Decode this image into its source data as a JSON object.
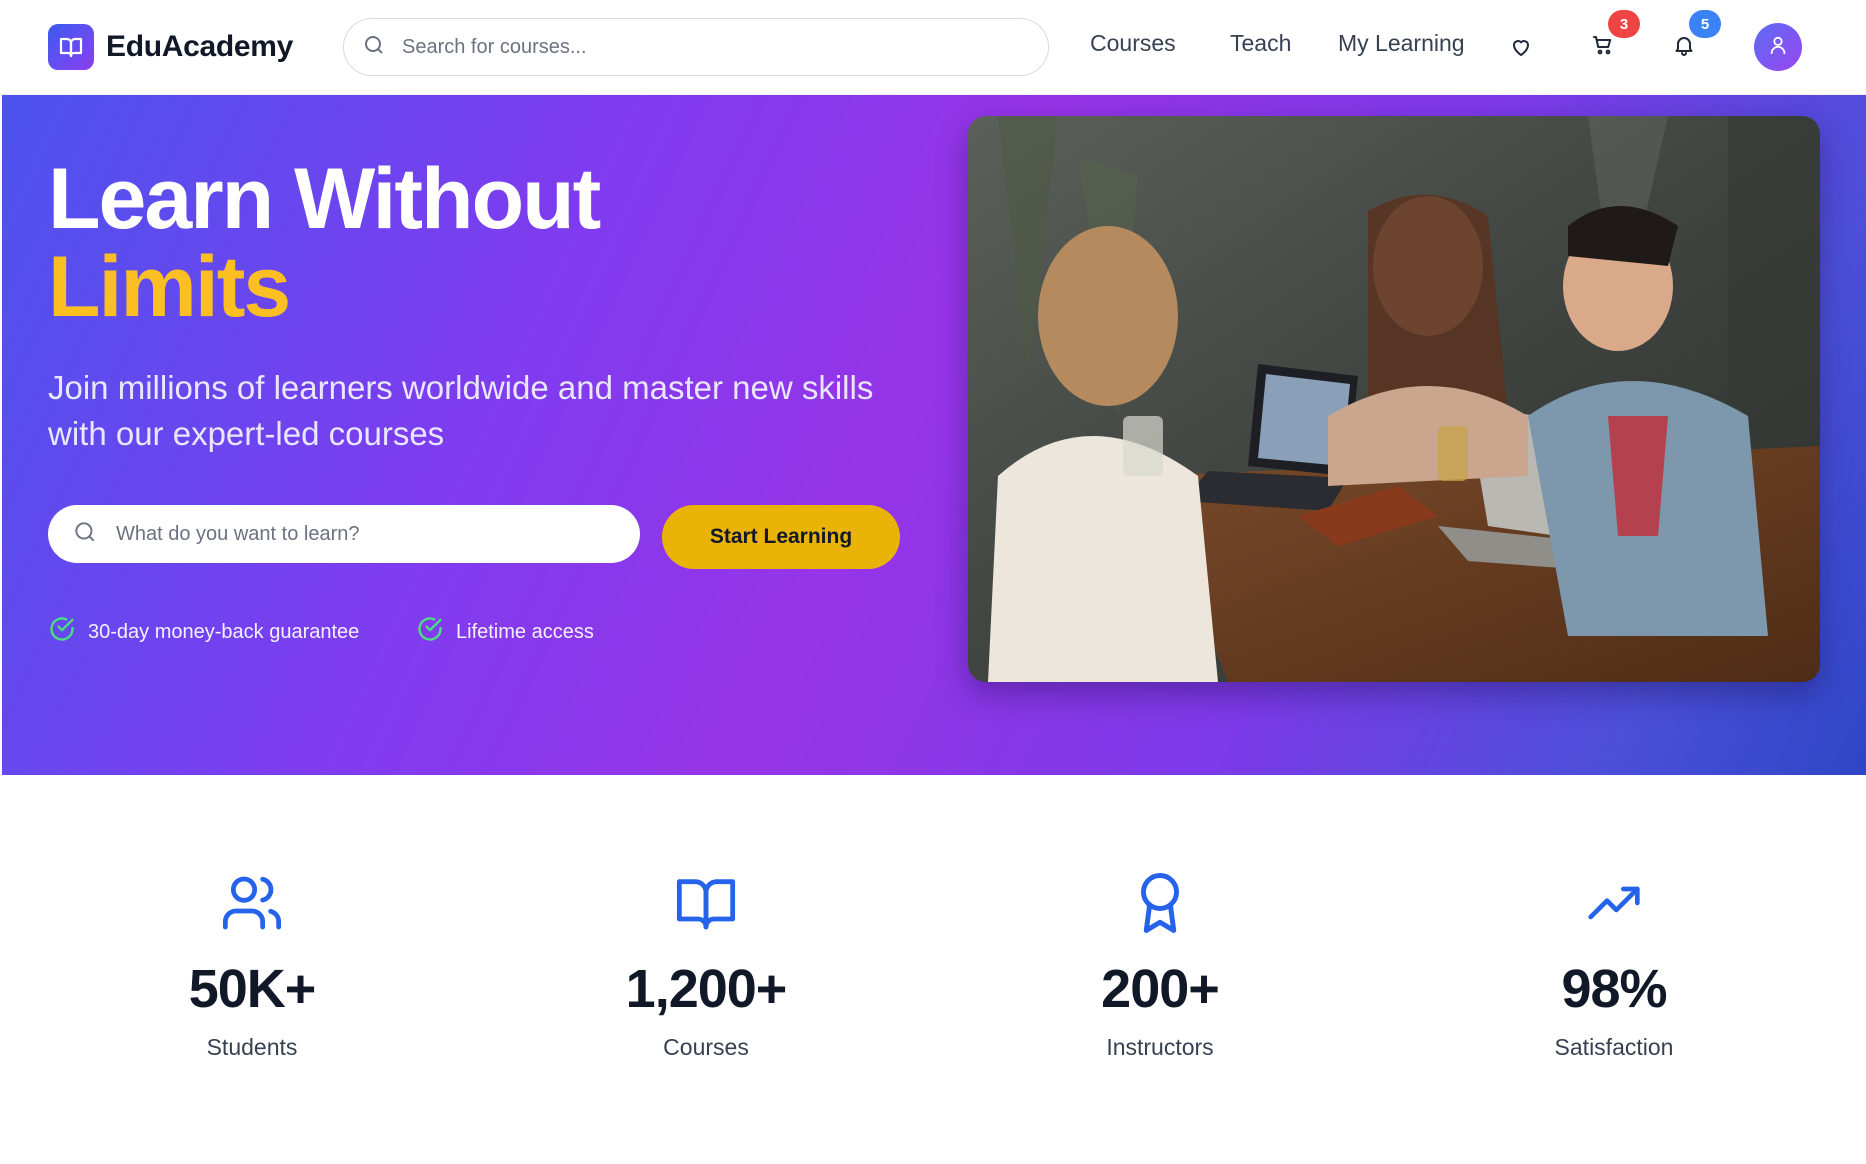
{
  "brand": {
    "name": "EduAcademy",
    "logo_icon": "book-open-icon",
    "gradient": [
      "#3b5bf0",
      "#8b3ff0"
    ]
  },
  "header": {
    "search_placeholder": "Search for courses...",
    "nav": {
      "courses": "Courses",
      "teach": "Teach",
      "my_learning": "My Learning"
    },
    "icons": {
      "wishlist": "heart-icon",
      "cart": "cart-icon",
      "notifications": "bell-icon",
      "avatar": "user-icon"
    },
    "cart_badge": "3",
    "cart_badge_color": "#ef4444",
    "notifications_badge": "5",
    "notifications_badge_color": "#3b82f6"
  },
  "hero": {
    "title_line1": "Learn Without",
    "title_line2": "Limits",
    "title_accent_color": "#fbbf24",
    "subtitle": "Join millions of learners worldwide and master new skills with our expert-led courses",
    "search_placeholder": "What do you want to learn?",
    "cta_label": "Start Learning",
    "cta_color": "#eab308",
    "perks": [
      "30-day money-back guarantee",
      "Lifetime access"
    ],
    "perk_icon": "check-circle-icon",
    "image_alt": "Three students laughing around a table with laptops"
  },
  "stats": [
    {
      "icon": "users-icon",
      "value": "50K+",
      "label": "Students"
    },
    {
      "icon": "book-open-icon",
      "value": "1,200+",
      "label": "Courses"
    },
    {
      "icon": "award-icon",
      "value": "200+",
      "label": "Instructors"
    },
    {
      "icon": "trending-up-icon",
      "value": "98%",
      "label": "Satisfaction"
    }
  ],
  "colors": {
    "accent_blue": "#2563eb",
    "hero_gradient_start": "#4c54ee",
    "hero_gradient_mid": "#9634e8",
    "hero_gradient_end": "#2f46c6"
  }
}
